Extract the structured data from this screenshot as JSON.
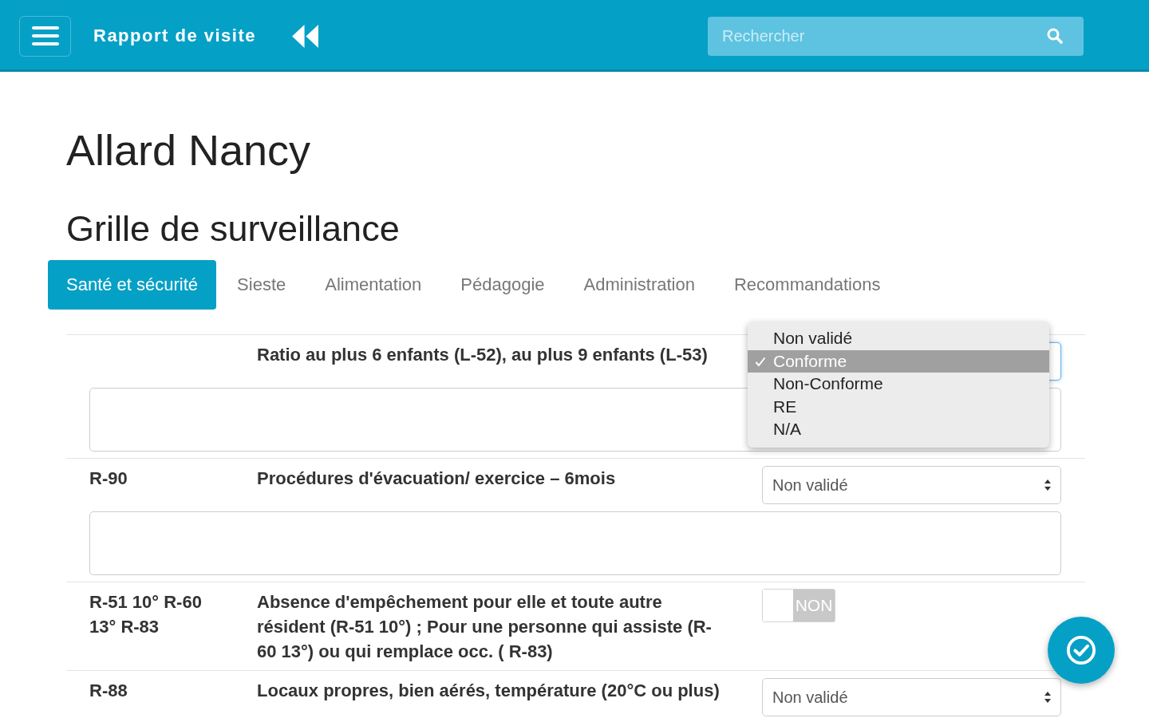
{
  "header": {
    "title": "Rapport de visite",
    "search": {
      "placeholder": "Rechercher"
    }
  },
  "person_name": "Allard Nancy",
  "section_title": "Grille de surveillance",
  "tabs": [
    {
      "label": "Santé et sécurité",
      "selected": true
    },
    {
      "label": "Sieste",
      "selected": false
    },
    {
      "label": "Alimentation",
      "selected": false
    },
    {
      "label": "Pédagogie",
      "selected": false
    },
    {
      "label": "Administration",
      "selected": false
    },
    {
      "label": "Recommandations",
      "selected": false
    }
  ],
  "rows": [
    {
      "description": "Ratio au plus 6 enfants (L-52), au plus 9 enfants (L-53)",
      "control": {
        "kind": "select",
        "open": true,
        "options": [
          {
            "label": "Non validé",
            "selected": false
          },
          {
            "label": "Conforme",
            "selected": true
          },
          {
            "label": "Non-Conforme",
            "selected": false
          },
          {
            "label": "RE",
            "selected": false
          },
          {
            "label": "N/A",
            "selected": false
          }
        ]
      },
      "note_field": true
    },
    {
      "code": "R-90",
      "description": "Procédures d'évacuation/ exercice – 6mois",
      "control": {
        "kind": "select",
        "open": false,
        "value": "Non validé"
      },
      "note_field": true
    },
    {
      "code": "R-51 10° R-60 13° R-83",
      "description": "Absence d'empêchement pour elle et toute autre résident (R-51 10°) ; Pour une personne qui assiste (R-60 13°) ou qui remplace occ. ( R-83)",
      "control": {
        "kind": "toggle",
        "on": false,
        "label": "NON"
      },
      "note_field": false
    },
    {
      "code": "R-88",
      "description": "Locaux propres, bien aérés, température (20°C ou plus)",
      "control": {
        "kind": "select",
        "open": false,
        "value": "Non validé"
      },
      "note_field": false
    }
  ]
}
